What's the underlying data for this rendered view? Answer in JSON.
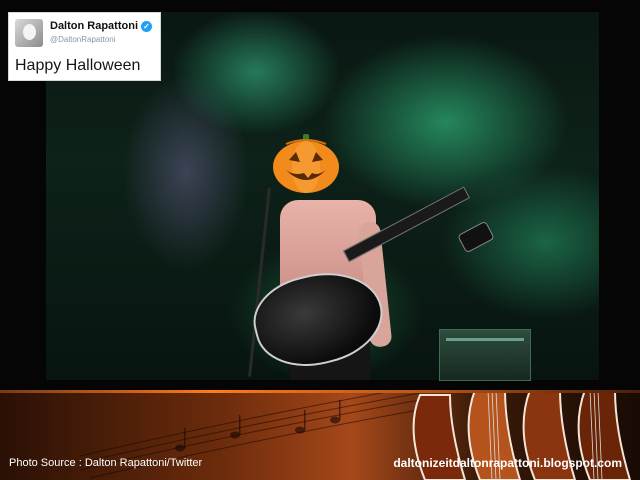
{
  "tweet": {
    "name": "Dalton Rapattoni",
    "handle": "@DaltonRapattoni",
    "text": "Happy Halloween"
  },
  "photo": {
    "overlay_icon": "pumpkin-icon"
  },
  "footer": {
    "photo_source": "Photo Source : Dalton Rapattoni/Twitter",
    "site": "daltonizeitdaltonrapattoni.blogspot.com"
  },
  "colors": {
    "background": "#000000",
    "smoke_green": "#3cc88c",
    "pumpkin_orange": "#f28a1c",
    "banner_orange": "#a6481a",
    "verified_blue": "#1da1f2"
  }
}
